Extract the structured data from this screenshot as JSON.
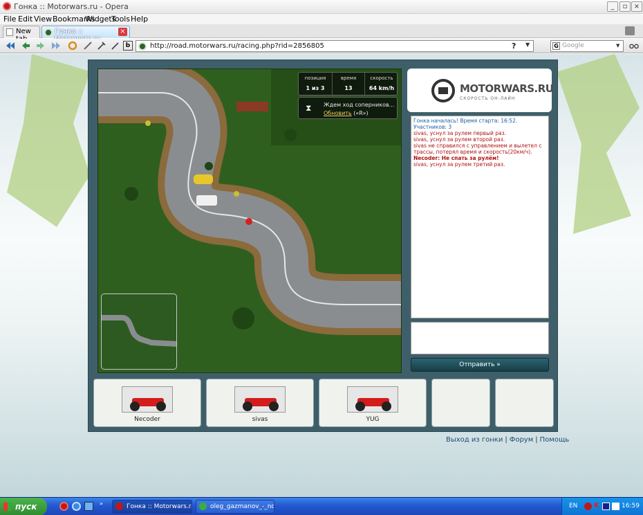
{
  "window": {
    "title": "Гонка :: Motorwars.ru - Opera"
  },
  "menu": [
    "File",
    "Edit",
    "View",
    "Bookmarks",
    "Widgets",
    "Tools",
    "Help"
  ],
  "tabs": [
    {
      "label": "New tab"
    },
    {
      "label": "Гонка :: Motorwars.ru"
    }
  ],
  "address": {
    "url": "http://road.motorwars.ru/racing.php?rid=2856805"
  },
  "search": {
    "placeholder": "Google"
  },
  "hud": {
    "position_label": "позиция",
    "position_value": "1 из 3",
    "time_label": "время",
    "time_value": "13",
    "speed_label": "скорость",
    "speed_value": "64 km/h"
  },
  "wait": {
    "text": "Ждем ход соперников...",
    "refresh_link": "Обновить",
    "refresh_key": "(«R»)"
  },
  "logo": {
    "brand": "MOTORWARS.RU",
    "tagline": "СКОРОСТЬ ОН-ЛАЙН"
  },
  "chat": {
    "messages": [
      {
        "text": "Гонка началась! Время старта: 16:52. Участников: 3",
        "color": "#1a5fa0",
        "bold": false
      },
      {
        "text": "sivas, уснул за рулем первый раз.",
        "color": "#b01010",
        "bold": false
      },
      {
        "text": "sivas, уснул за рулем второй раз.",
        "color": "#b01010",
        "bold": false
      },
      {
        "text": "sivas не справился с управлением и вылетел с трассы, потерял время и скорость(20км/ч).",
        "color": "#b01010",
        "bold": false
      },
      {
        "text": "Necoder: Не спать за рулём!",
        "color": "#b01010",
        "bold": true
      },
      {
        "text": "sivas, уснул за рулем третий раз.",
        "color": "#b01010",
        "bold": false
      }
    ]
  },
  "send_button": "Отправить »",
  "players": [
    {
      "name": "Necoder"
    },
    {
      "name": "sivas"
    },
    {
      "name": "YUG"
    }
  ],
  "links": [
    "Выход из гонки",
    "Форум",
    "Помощь"
  ],
  "taskbar": {
    "start": "пуск",
    "tasks": [
      {
        "label": "Гонка :: Motorwars.r..."
      },
      {
        "label": "oleg_gazmanov_-_no..."
      }
    ],
    "lang": "EN",
    "clock": "16:59"
  },
  "colors": {
    "frame": "#3e5f6a",
    "grass": "#2f5f1e",
    "road": "#8a8d90",
    "send_button": "#1f4e58",
    "links": "#1a4d70"
  }
}
